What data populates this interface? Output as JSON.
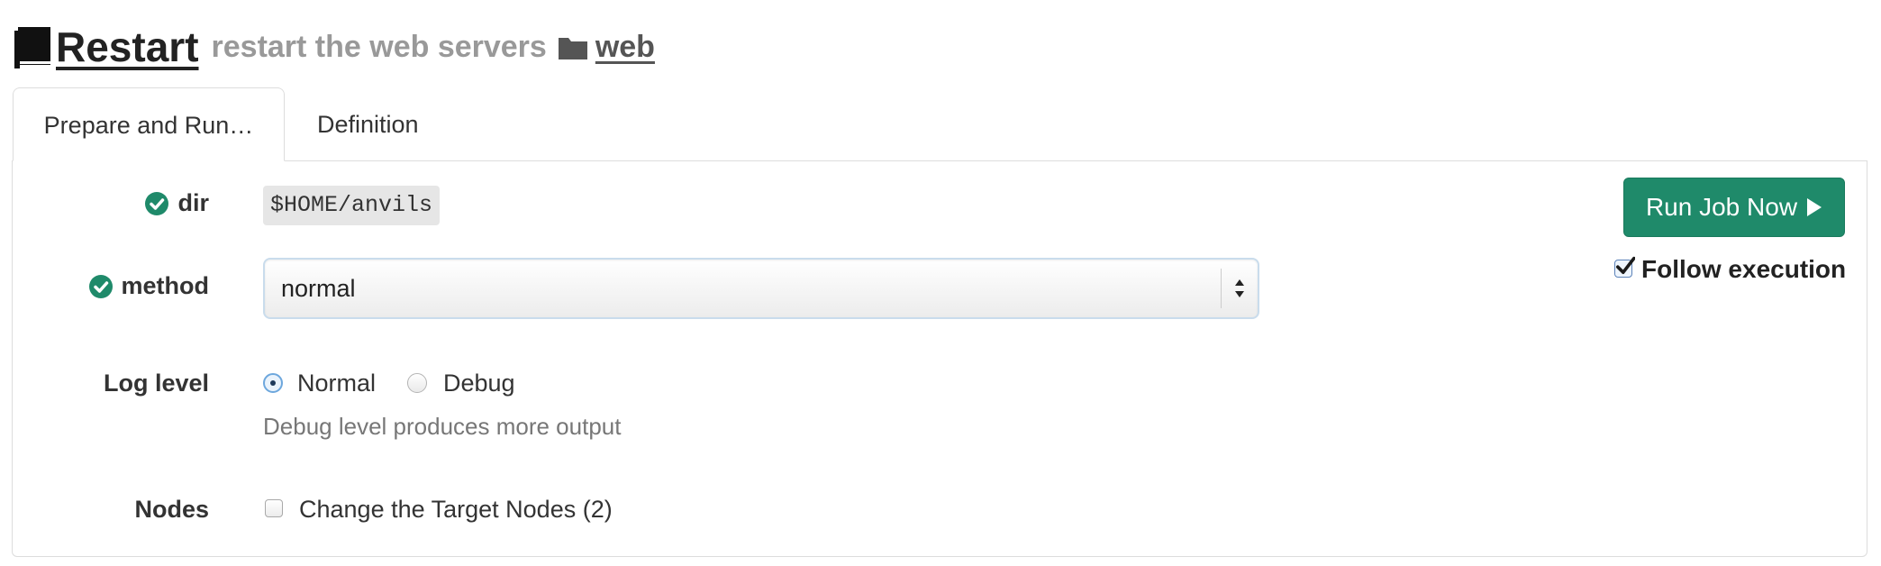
{
  "header": {
    "job_name": "Restart",
    "description": "restart the web servers",
    "group": "web",
    "icons": {
      "job": "book-icon",
      "group": "folder-icon"
    }
  },
  "tabs": [
    {
      "label": "Prepare and Run…",
      "active": true
    },
    {
      "label": "Definition",
      "active": false
    }
  ],
  "form": {
    "dir": {
      "label": "dir",
      "value": "$HOME/anvils",
      "valid": true
    },
    "method": {
      "label": "method",
      "value": "normal",
      "valid": true
    },
    "log_level": {
      "label": "Log level",
      "options": [
        "Normal",
        "Debug"
      ],
      "selected": "Normal",
      "help": "Debug level produces more output"
    },
    "nodes": {
      "label": "Nodes",
      "checkbox_label": "Change the Target Nodes (2)",
      "checked": false
    }
  },
  "actions": {
    "run_label": "Run Job Now",
    "follow_label": "Follow execution",
    "follow_checked": true
  },
  "colors": {
    "primary": "#1f8a6a",
    "valid_icon": "#1f8a6a",
    "muted_text": "#999999",
    "help_text": "#777777"
  }
}
